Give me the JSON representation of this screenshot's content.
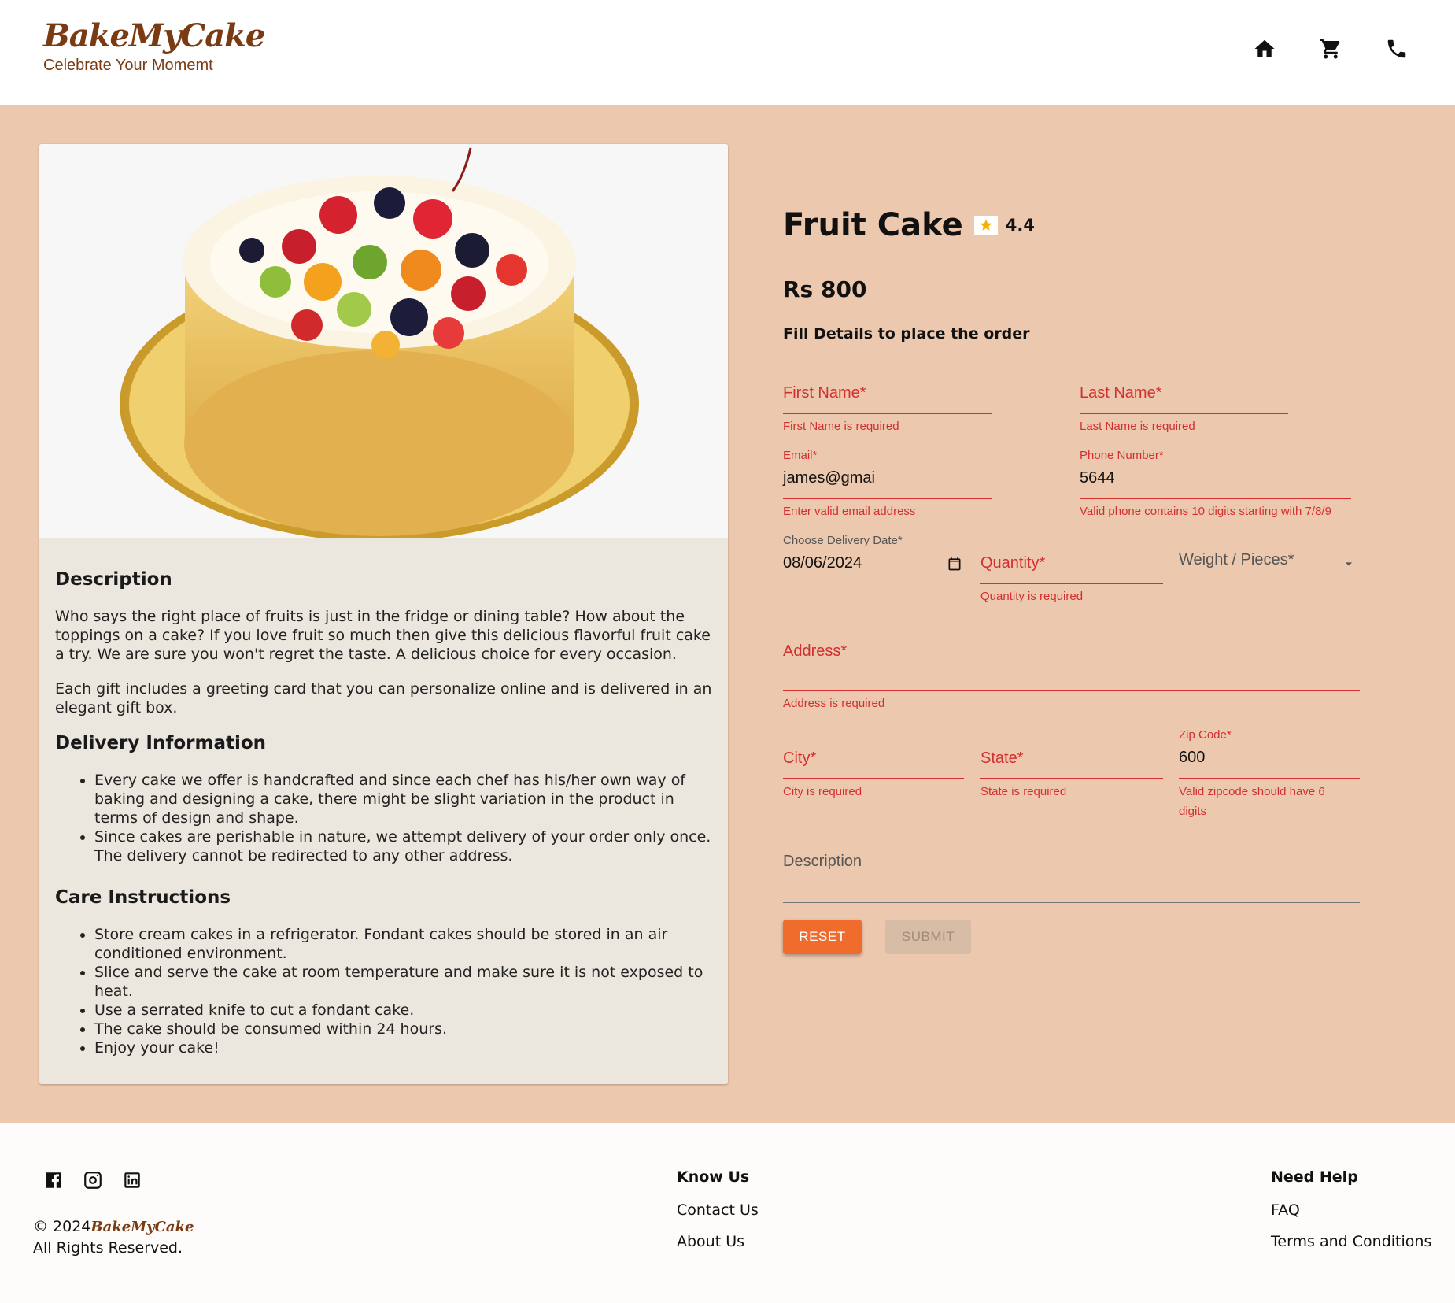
{
  "header": {
    "brand_name": "BakeMyCake",
    "tagline": "Celebrate Your Momemt",
    "icons": [
      "home-icon",
      "cart-icon",
      "phone-icon"
    ]
  },
  "product": {
    "name": "Fruit Cake",
    "rating": "4.4",
    "price": "Rs 800",
    "fill_details": "Fill Details to place the order"
  },
  "description": {
    "heading": "Description",
    "paragraphs": [
      "Who says the right place of fruits is just in the fridge or dining table? How about the toppings on a cake? If you love fruit so much then give this delicious flavorful fruit cake a try. We are sure you won't regret the taste. A delicious choice for every occasion.",
      "Each gift includes a greeting card that you can personalize online and is delivered in an elegant gift box."
    ],
    "delivery_heading": "Delivery Information",
    "delivery_items": [
      "Every cake we offer is handcrafted and since each chef has his/her own way of baking and designing a cake, there might be slight variation in the product in terms of design and shape.",
      "Since cakes are perishable in nature, we attempt delivery of your order only once. The delivery cannot be redirected to any other address."
    ],
    "care_heading": "Care Instructions",
    "care_items": [
      "Store cream cakes in a refrigerator. Fondant cakes should be stored in an air conditioned environment.",
      "Slice and serve the cake at room temperature and make sure it is not exposed to heat.",
      "Use a serrated knife to cut a fondant cake.",
      "The cake should be consumed within 24 hours.",
      "Enjoy your cake!"
    ]
  },
  "form": {
    "first_name": {
      "label": "First Name*",
      "error": "First Name is required"
    },
    "last_name": {
      "label": "Last Name*",
      "error": "Last Name is required"
    },
    "email": {
      "label": "Email*",
      "value": "james@gmai",
      "error": "Enter valid email address"
    },
    "phone": {
      "label": "Phone Number*",
      "value": "5644",
      "error": "Valid phone contains 10 digits starting with 7/8/9"
    },
    "delivery_date": {
      "label": "Choose Delivery Date*",
      "value": "08/06/2024"
    },
    "quantity": {
      "label": "Quantity*",
      "error": "Quantity is required"
    },
    "weight": {
      "label": "Weight / Pieces*"
    },
    "address": {
      "label": "Address*",
      "error": "Address is required"
    },
    "city": {
      "label": "City*",
      "error": "City is required"
    },
    "state": {
      "label": "State*",
      "error": "State is required"
    },
    "zip": {
      "label": "Zip Code*",
      "value": "600",
      "error": "Valid zipcode should have 6 digits"
    },
    "notes": {
      "label": "Description"
    },
    "reset_label": "RESET",
    "submit_label": "SUBMIT"
  },
  "footer": {
    "social_icons": [
      "facebook-icon",
      "instagram-icon",
      "linkedin-icon"
    ],
    "copyright_prefix": "© 2024",
    "copyright_brand": "BakeMyCake",
    "rights": "All Rights Reserved.",
    "know_us": {
      "heading": "Know Us",
      "links": [
        "Contact Us",
        "About Us"
      ]
    },
    "need_help": {
      "heading": "Need Help",
      "links": [
        "FAQ",
        "Terms and Conditions"
      ]
    }
  },
  "colors": {
    "brand": "#7a3a12",
    "background_band": "#ecc8ae",
    "card": "#ece7de",
    "error": "#d32f2f",
    "accent_button": "#ef6c2d",
    "star": "#f5b301"
  }
}
